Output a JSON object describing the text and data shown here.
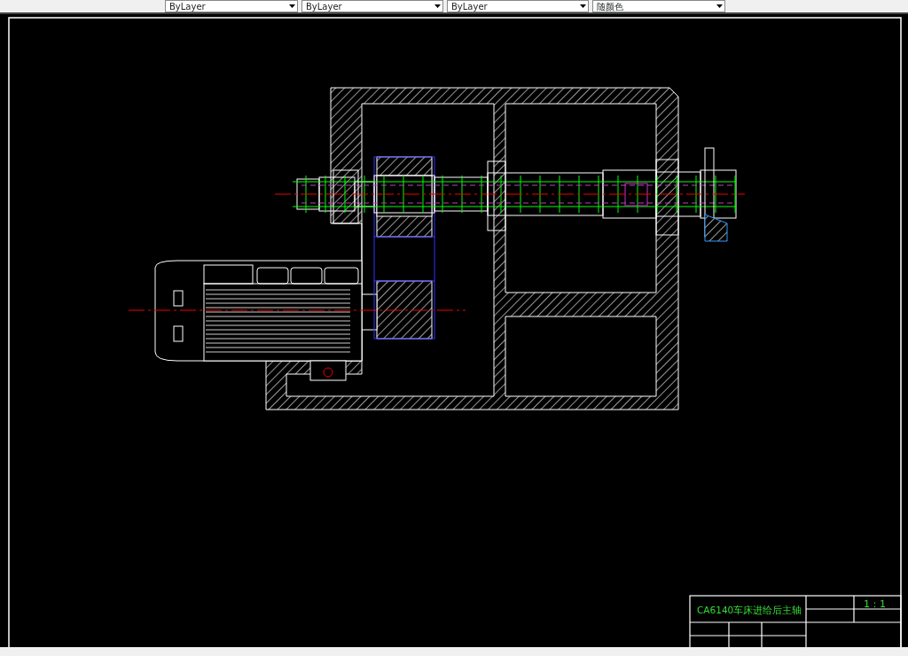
{
  "toolbar": {
    "dropdowns": [
      {
        "value": "ByLayer"
      },
      {
        "value": "ByLayer"
      },
      {
        "value": "ByLayer"
      },
      {
        "value": "随颜色"
      }
    ]
  },
  "drawing": {
    "title_block": {
      "title": "CA6140车床进给后主轴",
      "scale": "1：1"
    }
  }
}
